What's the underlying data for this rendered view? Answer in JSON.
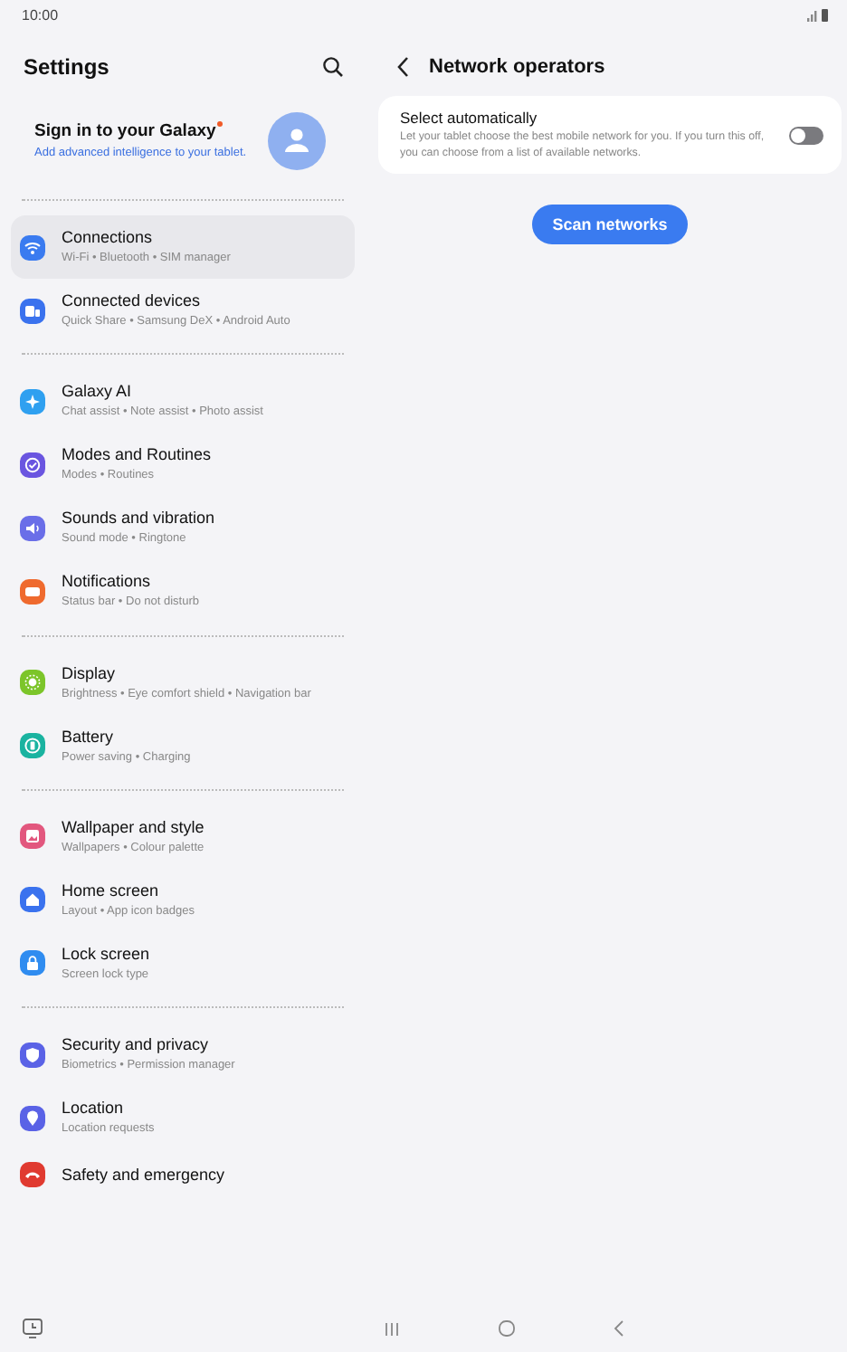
{
  "status_bar": {
    "time": "10:00"
  },
  "settings": {
    "title": "Settings",
    "account": {
      "title": "Sign in to your Galaxy",
      "new_badge": true,
      "subtitle": "Add advanced intelligence to your tablet."
    },
    "groups": [
      [
        {
          "title": "Connections",
          "subtitle": "Wi-Fi  •  Bluetooth  •  SIM manager",
          "color": "#3a7bf0",
          "selected": true
        },
        {
          "title": "Connected devices",
          "subtitle": "Quick Share  •  Samsung DeX  •  Android Auto",
          "color": "#3a72ee",
          "selected": false
        }
      ],
      [
        {
          "title": "Galaxy AI",
          "subtitle": "Chat assist  •  Note assist  •  Photo assist",
          "color": "#2fa0f0",
          "selected": false
        },
        {
          "title": "Modes and Routines",
          "subtitle": "Modes  •  Routines",
          "color": "#6a55e0",
          "selected": false
        },
        {
          "title": "Sounds and vibration",
          "subtitle": "Sound mode  •  Ringtone",
          "color": "#6a6ee8",
          "selected": false
        },
        {
          "title": "Notifications",
          "subtitle": "Status bar  •  Do not disturb",
          "color": "#ef6a2e",
          "selected": false
        }
      ],
      [
        {
          "title": "Display",
          "subtitle": "Brightness  •  Eye comfort shield  •  Navigation bar",
          "color": "#7cc52a",
          "selected": false
        },
        {
          "title": "Battery",
          "subtitle": "Power saving  •  Charging",
          "color": "#1ab3a0",
          "selected": false
        }
      ],
      [
        {
          "title": "Wallpaper and style",
          "subtitle": "Wallpapers  •  Colour palette",
          "color": "#e2577e",
          "selected": false
        },
        {
          "title": "Home screen",
          "subtitle": "Layout  •  App icon badges",
          "color": "#3a72ee",
          "selected": false
        },
        {
          "title": "Lock screen",
          "subtitle": "Screen lock type",
          "color": "#2f8cf0",
          "selected": false
        }
      ],
      [
        {
          "title": "Security and privacy",
          "subtitle": "Biometrics  •  Permission manager",
          "color": "#5a62e6",
          "selected": false
        },
        {
          "title": "Location",
          "subtitle": "Location requests",
          "color": "#5a62e6",
          "selected": false
        },
        {
          "title": "Safety and emergency",
          "color": "#e03a30",
          "selected": false
        }
      ]
    ]
  },
  "detail": {
    "title": "Network operators",
    "option": {
      "title": "Select automatically",
      "description": "Let your tablet choose the best mobile network for you. If you turn this off, you can choose from a list of available networks.",
      "on": false
    },
    "button": "Scan networks"
  }
}
